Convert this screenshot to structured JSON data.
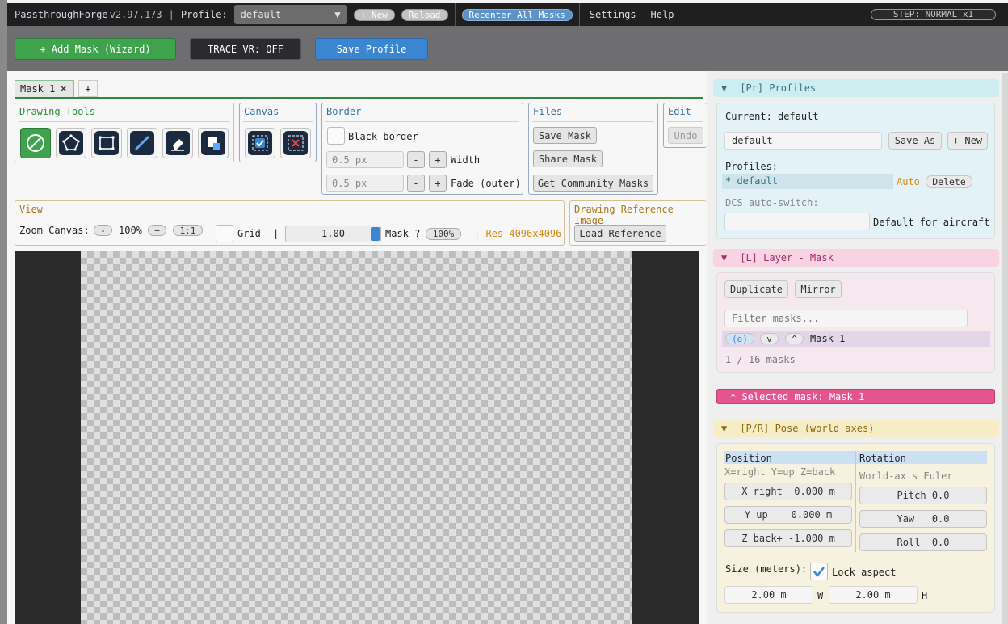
{
  "menubar": {
    "app_name": "PassthroughForge",
    "version": "v2.97.173",
    "sep": "|",
    "profile_label": "Profile:",
    "profile_value": "default",
    "dropdown_icon": "▼",
    "new_label": "+ New",
    "reload_label": "Reload",
    "recenter_label": "Recenter All Masks",
    "settings_label": "Settings",
    "help_label": "Help",
    "step_label": "STEP: NORMAL  x1"
  },
  "toolbar": {
    "add_mask_label": "+  Add Mask  (Wizard)",
    "trace_label": "TRACE VR: OFF",
    "save_profile_label": "Save Profile"
  },
  "tabs": {
    "mask_tab": "Mask 1",
    "close_icon": "×",
    "add_tab": "+"
  },
  "drawing_tools": {
    "title": "Drawing Tools",
    "tools": [
      "none-icon",
      "polygon-icon",
      "rectangle-icon",
      "pen-icon",
      "eraser-icon",
      "fill-icon"
    ]
  },
  "canvas_grp": {
    "title": "Canvas",
    "select_all": "select-all-icon",
    "clear": "clear-icon"
  },
  "border": {
    "title": "Border",
    "black_border_label": "Black border",
    "width_value": "0.5 px",
    "width_label": "Width",
    "fade_value": "0.5 px",
    "fade_label": "Fade (outer)",
    "minus": "-",
    "plus": "+"
  },
  "files": {
    "title": "Files",
    "save_mask": "Save Mask",
    "share_mask": "Share Mask",
    "community": "Get Community Masks"
  },
  "edit": {
    "title": "Edit",
    "undo": "Undo"
  },
  "view": {
    "title": "View",
    "zoom_label": "Zoom Canvas:",
    "zoom_minus": "-",
    "zoom_value": "100%",
    "zoom_plus": "+",
    "one_to_one": "1:1",
    "grid_label": "Grid",
    "bar": "|",
    "opacity_value": "1.00",
    "mask_label": "Mask ?",
    "mask_pct": "100%",
    "res_label": "| Res 4096x4096"
  },
  "reference": {
    "title": "Drawing Reference Image",
    "load_label": "Load Reference"
  },
  "profiles": {
    "header": "[Pr] Profiles",
    "arrow": "▼",
    "current": "Current: default",
    "name_value": "default",
    "save_as": "Save As",
    "new": "+ New",
    "profiles_label": "Profiles:",
    "item": "* default",
    "auto": "Auto",
    "delete": "Delete",
    "dcs_label": "DCS auto-switch:",
    "default_aircraft": "Default for aircraft"
  },
  "layer": {
    "header": "[L] Layer - Mask",
    "arrow": "▼",
    "duplicate": "Duplicate",
    "mirror": "Mirror",
    "filter_placeholder": "Filter masks...",
    "vis_btn": "(o)",
    "down_btn": "v",
    "up_btn": "^",
    "mask_name": "Mask 1",
    "count": "1 / 16 masks"
  },
  "selected": {
    "label": "*  Selected mask:  Mask 1"
  },
  "pose": {
    "header": "[P/R] Pose (world axes)",
    "arrow": "▼",
    "position_label": "Position",
    "rotation_label": "Rotation",
    "axes_hint": "X=right Y=up Z=back",
    "euler_hint": "World-axis Euler",
    "x_field": "X right  0.000 m",
    "y_field": "Y up    0.000 m",
    "z_field": "Z back+ -1.000 m",
    "pitch": "Pitch 0.0",
    "yaw": "Yaw   0.0",
    "roll": "Roll  0.0",
    "size_label": "Size (meters):",
    "lock_label": "Lock aspect",
    "w_value": "2.00 m",
    "w_label": "W",
    "h_value": "2.00 m",
    "h_label": "H"
  },
  "colors": {
    "accent_green": "#3fa34d",
    "accent_blue": "#3a86d0",
    "profiles_bg": "#cdeef0",
    "layer_bg": "#f7d3e3",
    "selected_bg": "#e4558f",
    "pose_bg": "#f6ecc6"
  }
}
